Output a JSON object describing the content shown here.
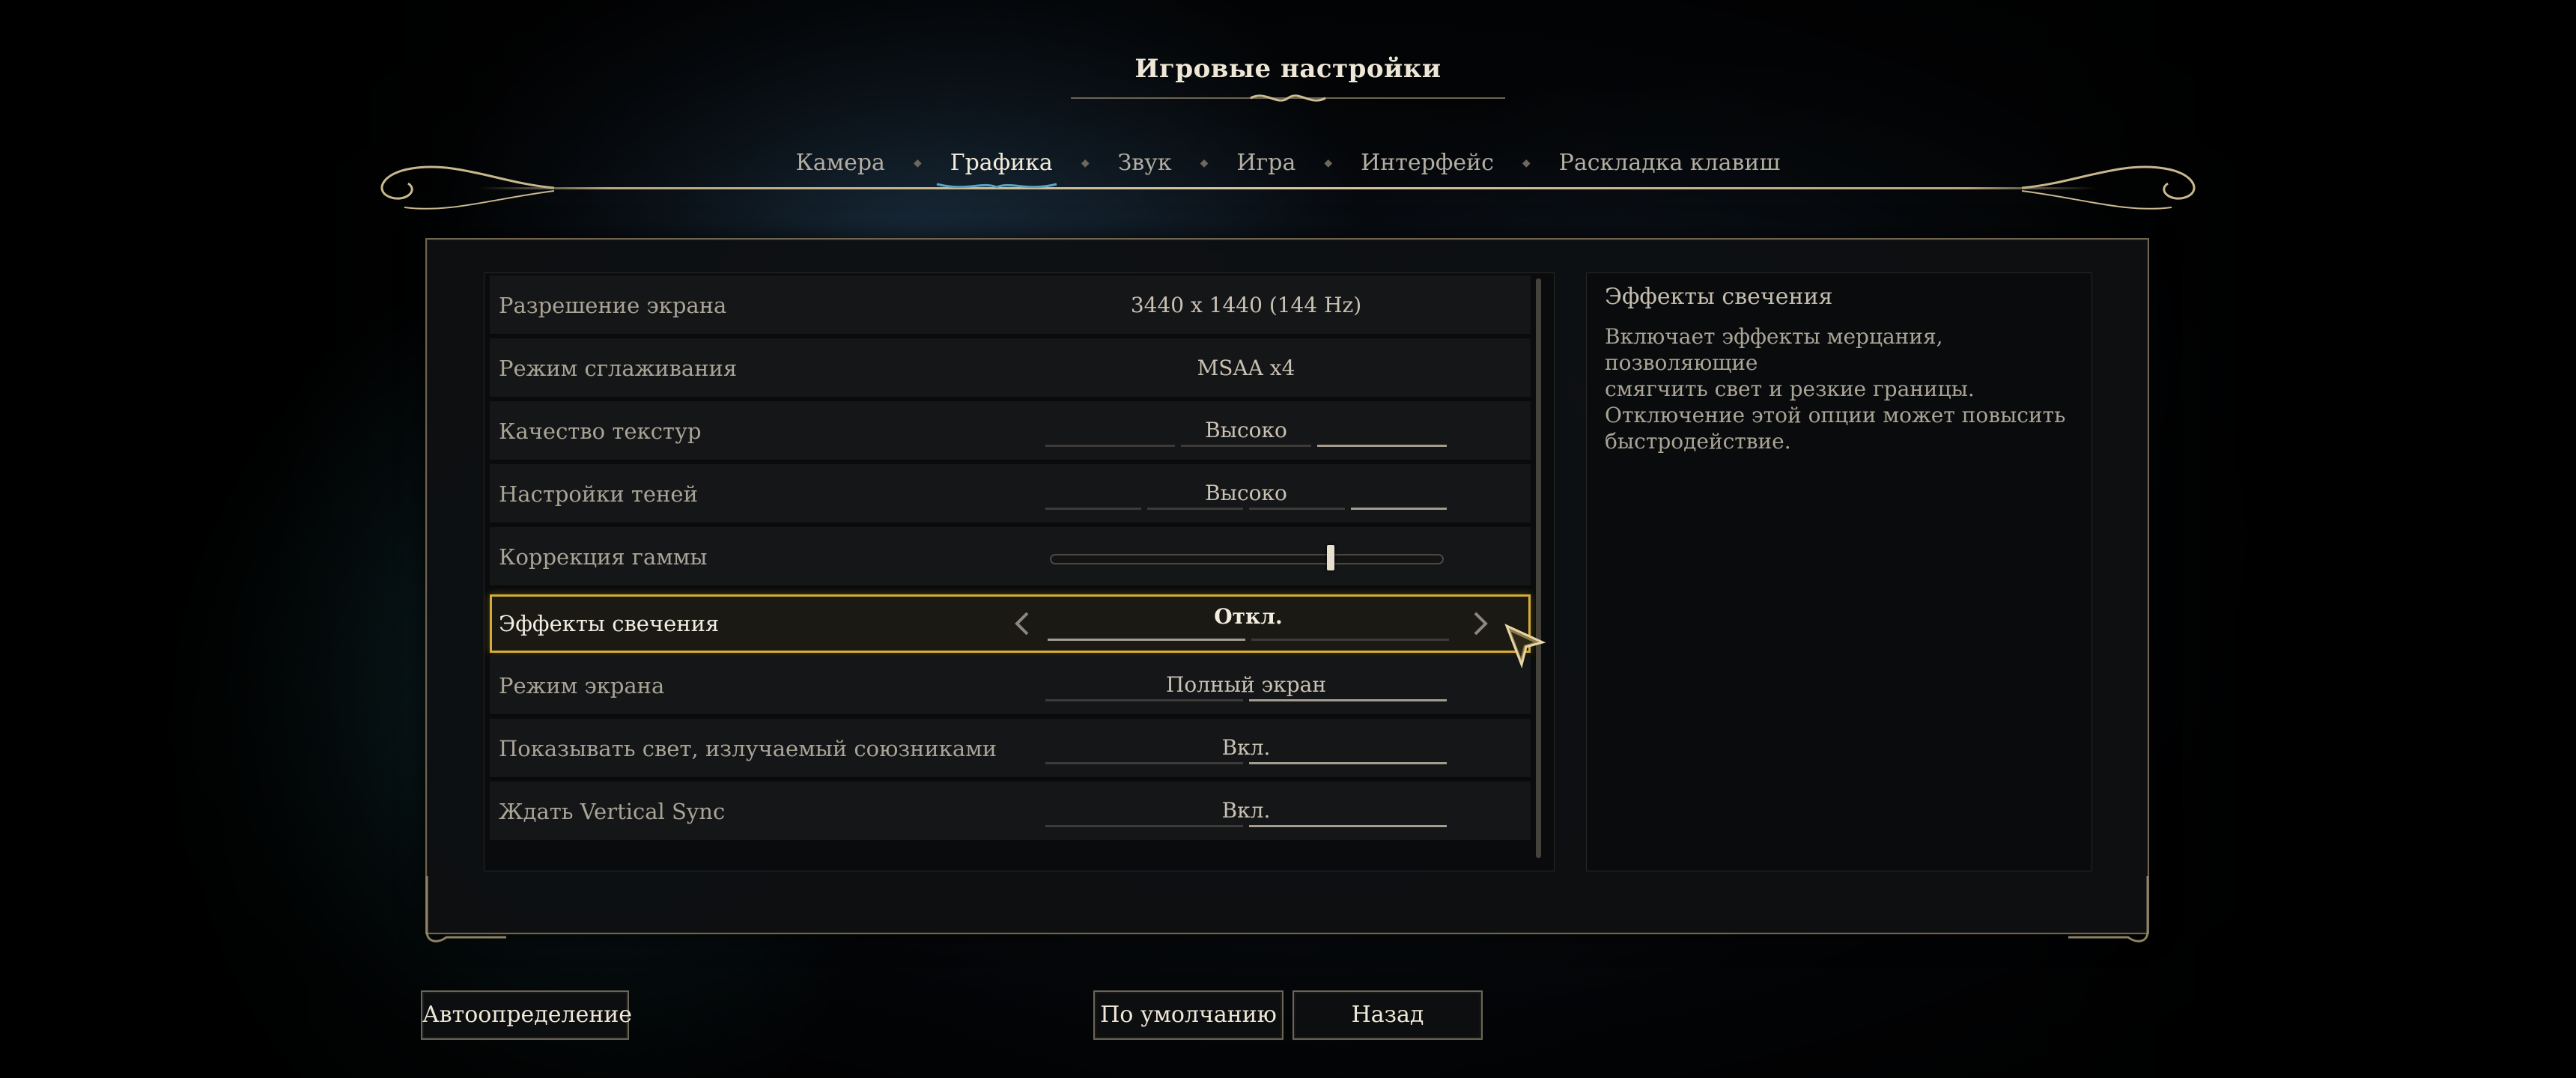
{
  "title": "Игровые настройки",
  "tabs": [
    {
      "label": "Камера",
      "active": false
    },
    {
      "label": "Графика",
      "active": true
    },
    {
      "label": "Звук",
      "active": false
    },
    {
      "label": "Игра",
      "active": false
    },
    {
      "label": "Интерфейс",
      "active": false
    },
    {
      "label": "Раскладка клавиш",
      "active": false
    }
  ],
  "settings": [
    {
      "label": "Разрешение экрана",
      "value": "3440 x 1440 (144 Hz)",
      "segments": 0,
      "selected_index": 0
    },
    {
      "label": "Режим сглаживания",
      "value": "MSAA x4",
      "segments": 0,
      "selected_index": 0
    },
    {
      "label": "Качество текстур",
      "value": "Высоко",
      "segments": 3,
      "selected_index": 2
    },
    {
      "label": "Настройки теней",
      "value": "Высоко",
      "segments": 4,
      "selected_index": 3
    },
    {
      "label": "Коррекция гаммы",
      "slider_value": 0.71
    },
    {
      "label": "Эффекты свечения",
      "value": "Откл.",
      "segments": 2,
      "selected_index": 0,
      "selected": true
    },
    {
      "label": "Режим экрана",
      "value": "Полный экран",
      "segments": 2,
      "selected_index": 1
    },
    {
      "label": "Показывать свет, излучаемый союзниками",
      "value": "Вкл.",
      "segments": 2,
      "selected_index": 1
    },
    {
      "label": "Ждать Vertical Sync",
      "value": "Вкл.",
      "segments": 2,
      "selected_index": 1
    }
  ],
  "description": {
    "title": "Эффекты свечения",
    "lines": [
      "Включает эффекты мерцания, позволяющие",
      "смягчить свет и резкие границы.",
      "Отключение этой опции может повысить",
      "быстродействие."
    ]
  },
  "buttons": {
    "autodetect": "Автоопределение",
    "defaults": "По умолчанию",
    "back": "Назад"
  },
  "colors": {
    "accent_gold": "#d4ac38",
    "frame": "#6e6450",
    "text": "#cfc8bb"
  }
}
